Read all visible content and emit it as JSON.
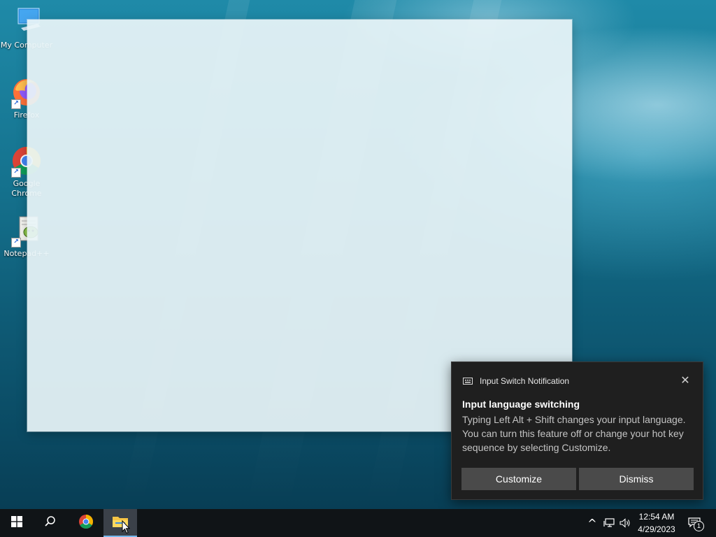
{
  "desktop": {
    "icons": [
      {
        "label": "My Computer",
        "icon": "monitor-icon"
      },
      {
        "label": "Firefox",
        "icon": "firefox-icon"
      },
      {
        "label": "Google Chrome",
        "icon": "chrome-icon"
      },
      {
        "label": "Notepad++",
        "icon": "notepadpp-icon"
      }
    ]
  },
  "notification": {
    "app_name": "Input Switch Notification",
    "title": "Input language switching",
    "body": "Typing Left Alt + Shift changes your input language. You can turn this feature off or change your hot key sequence by selecting Customize.",
    "customize_label": "Customize",
    "dismiss_label": "Dismiss",
    "close_glyph": "✕"
  },
  "taskbar": {
    "start_icon": "windows-logo-icon",
    "search_icon": "search-icon",
    "pinned": [
      "chrome-icon",
      "file-explorer-icon"
    ],
    "active_app": "file-explorer-icon",
    "tray": {
      "chevron_glyph": "^",
      "time": "12:54 AM",
      "date": "4/29/2023",
      "notification_count": "1"
    }
  },
  "colors": {
    "accent": "#76b9ed",
    "toast_bg": "#1f1f1f",
    "taskbar_bg": "#101417"
  }
}
